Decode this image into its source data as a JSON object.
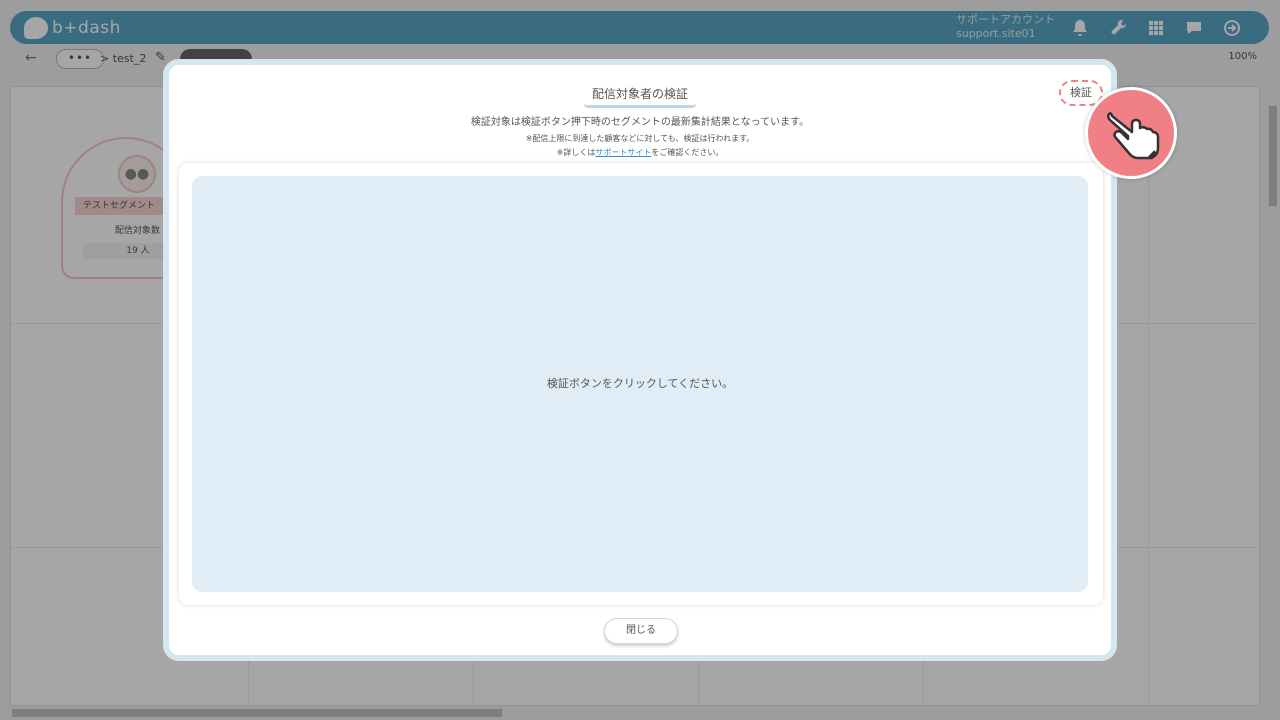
{
  "app": {
    "logo_text": "b+dash",
    "account_name": "サポートアカウント",
    "account_id": "support.site01"
  },
  "topbar": {
    "icons": [
      "bell-icon",
      "wrench-icon",
      "grid-icon",
      "chat-icon",
      "logout-icon"
    ]
  },
  "toolbar": {
    "back_glyph": "←",
    "crumb_dots": "•••",
    "crumb_name": "> test_2",
    "zoom": "100%"
  },
  "node": {
    "title": "テストセグメント",
    "subtitle": "配信対象数",
    "count": "19 人"
  },
  "modal": {
    "title": "配信対象者の検証",
    "description": "検証対象は検証ボタン押下時のセグメントの最新集計結果となっています。",
    "note1": "※配信上限に到達した顧客などに対しても、検証は行われます。",
    "note2_prefix": "※詳しくは",
    "note2_link": "サポートサイト",
    "note2_suffix": "をご確認ください。",
    "verify_button": "検証",
    "empty_message": "検証ボタンをクリックしてください。",
    "close_button": "閉じる"
  },
  "colors": {
    "accent": "#5aa6c6",
    "highlight": "#f07f86",
    "panel": "#e1edf6"
  }
}
